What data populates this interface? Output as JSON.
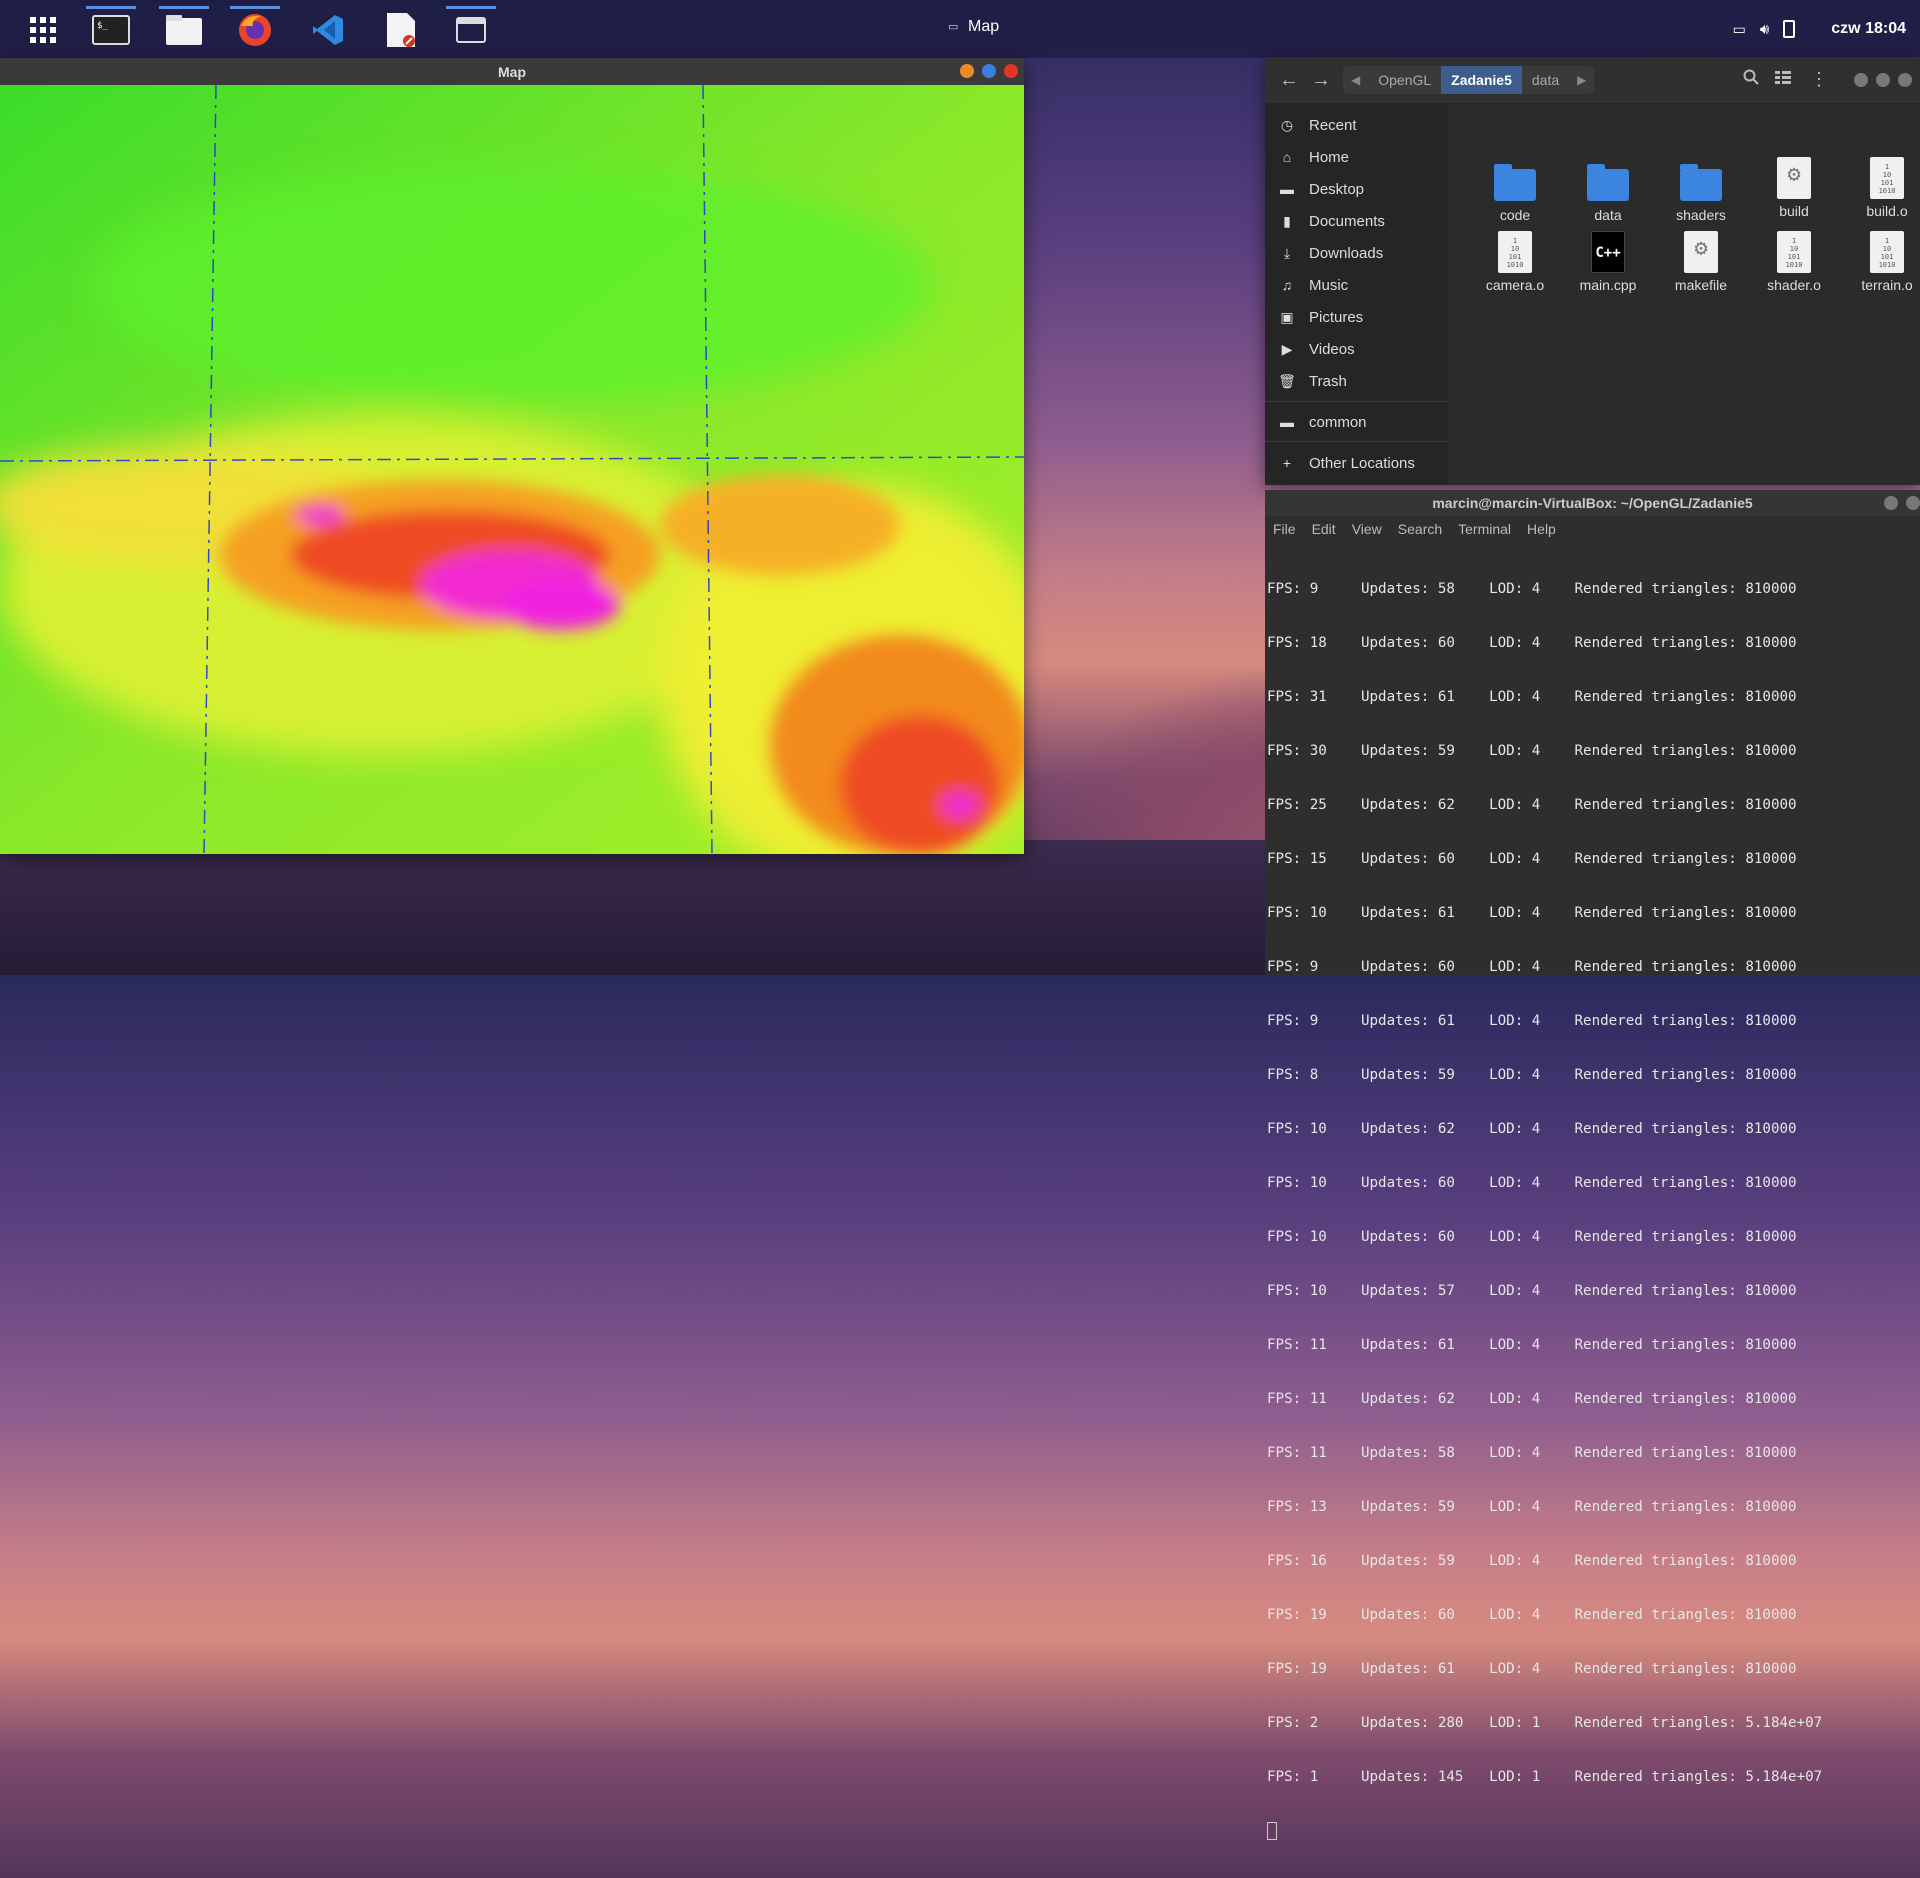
{
  "topbar": {
    "window_title": "Map",
    "clock": "czw 18:04",
    "apps": [
      {
        "name": "apps-grid-icon"
      },
      {
        "name": "terminal-icon"
      },
      {
        "name": "files-icon"
      },
      {
        "name": "firefox-icon"
      },
      {
        "name": "vscode-icon"
      },
      {
        "name": "text-editor-icon"
      },
      {
        "name": "window-icon"
      }
    ]
  },
  "map_window": {
    "title": "Map"
  },
  "files": {
    "breadcrumbs": [
      "OpenGL",
      "Zadanie5",
      "data"
    ],
    "active_crumb": "Zadanie5",
    "sidebar": [
      {
        "label": "Recent",
        "icon": "clock-icon"
      },
      {
        "label": "Home",
        "icon": "home-icon"
      },
      {
        "label": "Desktop",
        "icon": "desktop-icon"
      },
      {
        "label": "Documents",
        "icon": "document-icon"
      },
      {
        "label": "Downloads",
        "icon": "download-icon"
      },
      {
        "label": "Music",
        "icon": "music-icon"
      },
      {
        "label": "Pictures",
        "icon": "picture-icon"
      },
      {
        "label": "Videos",
        "icon": "video-icon"
      },
      {
        "label": "Trash",
        "icon": "trash-icon"
      },
      {
        "label": "common",
        "icon": "folder-icon"
      },
      {
        "label": "Other Locations",
        "icon": "plus-icon"
      }
    ],
    "items": [
      {
        "label": "code",
        "type": "folder"
      },
      {
        "label": "data",
        "type": "folder"
      },
      {
        "label": "shaders",
        "type": "folder"
      },
      {
        "label": "build",
        "type": "gear"
      },
      {
        "label": "build.o",
        "type": "binary"
      },
      {
        "label": "camera.o",
        "type": "binary"
      },
      {
        "label": "main.cpp",
        "type": "cpp"
      },
      {
        "label": "makefile",
        "type": "gear"
      },
      {
        "label": "shader.o",
        "type": "binary"
      },
      {
        "label": "terrain.o",
        "type": "binary"
      }
    ]
  },
  "terminal": {
    "title": "marcin@marcin-VirtualBox: ~/OpenGL/Zadanie5",
    "menu": [
      "File",
      "Edit",
      "View",
      "Search",
      "Terminal",
      "Help"
    ],
    "lines": [
      "FPS: 9     Updates: 58    LOD: 4    Rendered triangles: 810000",
      "FPS: 18    Updates: 60    LOD: 4    Rendered triangles: 810000",
      "FPS: 31    Updates: 61    LOD: 4    Rendered triangles: 810000",
      "FPS: 30    Updates: 59    LOD: 4    Rendered triangles: 810000",
      "FPS: 25    Updates: 62    LOD: 4    Rendered triangles: 810000",
      "FPS: 15    Updates: 60    LOD: 4    Rendered triangles: 810000",
      "FPS: 10    Updates: 61    LOD: 4    Rendered triangles: 810000",
      "FPS: 9     Updates: 60    LOD: 4    Rendered triangles: 810000",
      "FPS: 9     Updates: 61    LOD: 4    Rendered triangles: 810000",
      "FPS: 8     Updates: 59    LOD: 4    Rendered triangles: 810000",
      "FPS: 10    Updates: 62    LOD: 4    Rendered triangles: 810000",
      "FPS: 10    Updates: 60    LOD: 4    Rendered triangles: 810000",
      "FPS: 10    Updates: 60    LOD: 4    Rendered triangles: 810000",
      "FPS: 10    Updates: 57    LOD: 4    Rendered triangles: 810000",
      "FPS: 11    Updates: 61    LOD: 4    Rendered triangles: 810000",
      "FPS: 11    Updates: 62    LOD: 4    Rendered triangles: 810000",
      "FPS: 11    Updates: 58    LOD: 4    Rendered triangles: 810000",
      "FPS: 13    Updates: 59    LOD: 4    Rendered triangles: 810000",
      "FPS: 16    Updates: 59    LOD: 4    Rendered triangles: 810000",
      "FPS: 19    Updates: 60    LOD: 4    Rendered triangles: 810000",
      "FPS: 19    Updates: 61    LOD: 4    Rendered triangles: 810000",
      "FPS: 2     Updates: 280   LOD: 1    Rendered triangles: 5.184e+07",
      "FPS: 1     Updates: 145   LOD: 1    Rendered triangles: 5.184e+07"
    ]
  }
}
